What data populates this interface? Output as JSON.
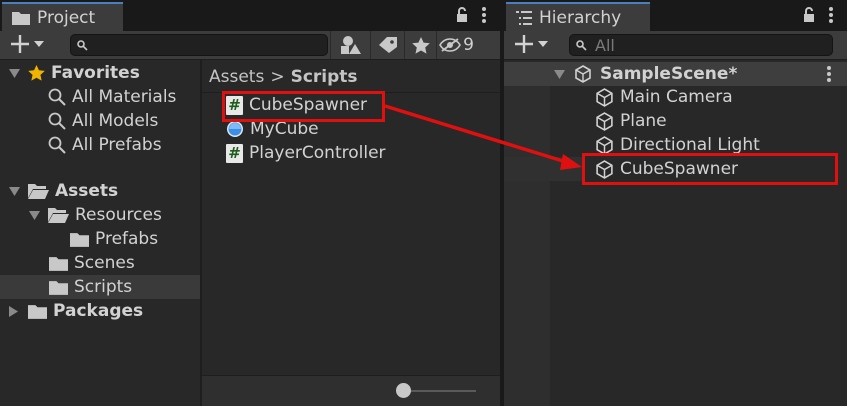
{
  "project": {
    "tab_title": "Project",
    "hidden_count": "9",
    "search_placeholder": "",
    "favorites": {
      "label": "Favorites",
      "items": [
        "All Materials",
        "All Models",
        "All Prefabs"
      ]
    },
    "assets": {
      "label": "Assets",
      "resources": "Resources",
      "prefabs": "Prefabs",
      "scenes": "Scenes",
      "scripts": "Scripts"
    },
    "packages": "Packages",
    "breadcrumb": {
      "root": "Assets",
      "separator": ">",
      "current": "Scripts"
    },
    "files": [
      {
        "name": "CubeSpawner",
        "icon": "csharp-script-icon"
      },
      {
        "name": "MyCube",
        "icon": "prefab-icon"
      },
      {
        "name": "PlayerController",
        "icon": "csharp-script-icon"
      }
    ]
  },
  "hierarchy": {
    "tab_title": "Hierarchy",
    "search_placeholder": "All",
    "scene": "SampleScene*",
    "objects": [
      "Main Camera",
      "Plane",
      "Directional Light",
      "CubeSpawner"
    ]
  },
  "colors": {
    "panel_bg": "#282828",
    "toolbar_bg": "#3c3c3c",
    "selection": "#3a3a3a",
    "annotation_red": "#e01010",
    "favorite_star": "#f0b400"
  }
}
